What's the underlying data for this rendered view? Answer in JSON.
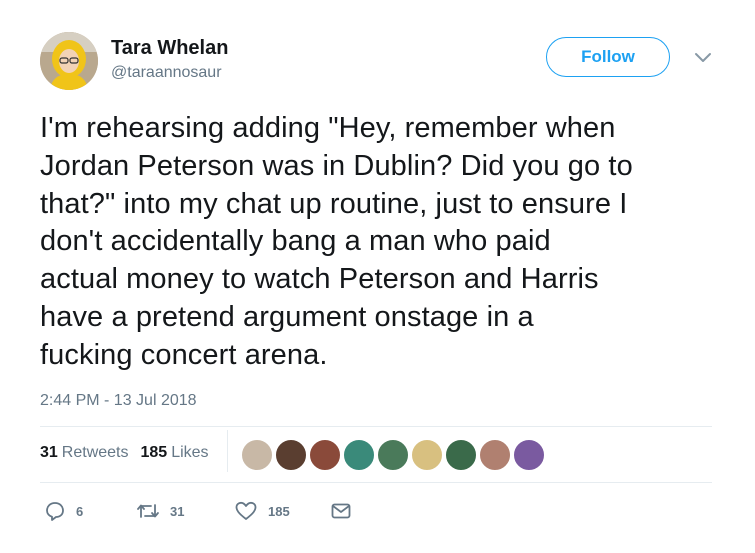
{
  "author": {
    "display_name": "Tara Whelan",
    "handle": "@taraannosaur"
  },
  "follow_label": "Follow",
  "tweet": {
    "text": "I'm rehearsing adding \"Hey, remember when\nJordan Peterson was in Dublin? Did you go to\nthat?\" into my chat up routine, just to ensure I\ndon't accidentally bang a man who paid\nactual money to watch Peterson and Harris\nhave a pretend argument onstage in a\nfucking concert arena.",
    "timestamp": "2:44 PM - 13 Jul 2018"
  },
  "stats": {
    "retweets_count": "31",
    "retweets_label": "Retweets",
    "likes_count": "185",
    "likes_label": "Likes"
  },
  "likers": [
    {
      "icon": "liker-avatar-1",
      "color": "#c8b8a6"
    },
    {
      "icon": "liker-avatar-2",
      "color": "#5a3e30"
    },
    {
      "icon": "liker-avatar-3",
      "color": "#8a4a3a"
    },
    {
      "icon": "liker-avatar-4",
      "color": "#3a8a7a"
    },
    {
      "icon": "liker-avatar-5",
      "color": "#4a7a5a"
    },
    {
      "icon": "liker-avatar-6",
      "color": "#d8c080"
    },
    {
      "icon": "liker-avatar-7",
      "color": "#3a6a4a"
    },
    {
      "icon": "liker-avatar-8",
      "color": "#b08070"
    },
    {
      "icon": "liker-avatar-9",
      "color": "#7a5aa0"
    }
  ],
  "actions": {
    "reply_count": "6",
    "retweet_count": "31",
    "like_count": "185"
  },
  "colors": {
    "accent": "#1da1f2",
    "muted": "#657786",
    "divider": "#e6ecf0"
  }
}
